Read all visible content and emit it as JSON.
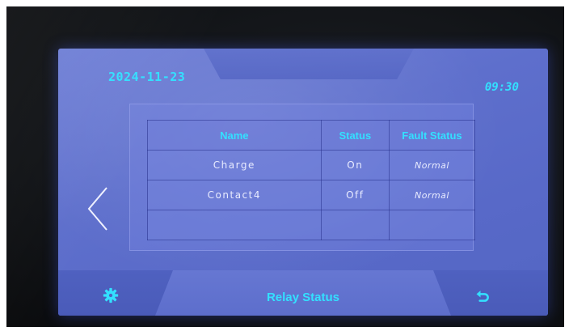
{
  "header": {
    "date": "2024-11-23",
    "time": "09:30"
  },
  "table": {
    "columns": [
      "Name",
      "Status",
      "Fault Status"
    ],
    "rows": [
      {
        "name": "Charge",
        "status": "On",
        "fault_status": "Normal"
      },
      {
        "name": "Contact4",
        "status": "Off",
        "fault_status": "Normal"
      },
      {
        "name": "",
        "status": "",
        "fault_status": ""
      }
    ]
  },
  "footer": {
    "title": "Relay Status",
    "settings_icon": "gear-icon",
    "back_icon": "back-arrow-icon"
  },
  "navigation": {
    "prev_icon": "chevron-left-icon",
    "next_icon": "chevron-right-icon"
  },
  "colors": {
    "accent": "#33e0ff",
    "screen_bg": "#5e6fcc",
    "text": "#e8ebff"
  }
}
